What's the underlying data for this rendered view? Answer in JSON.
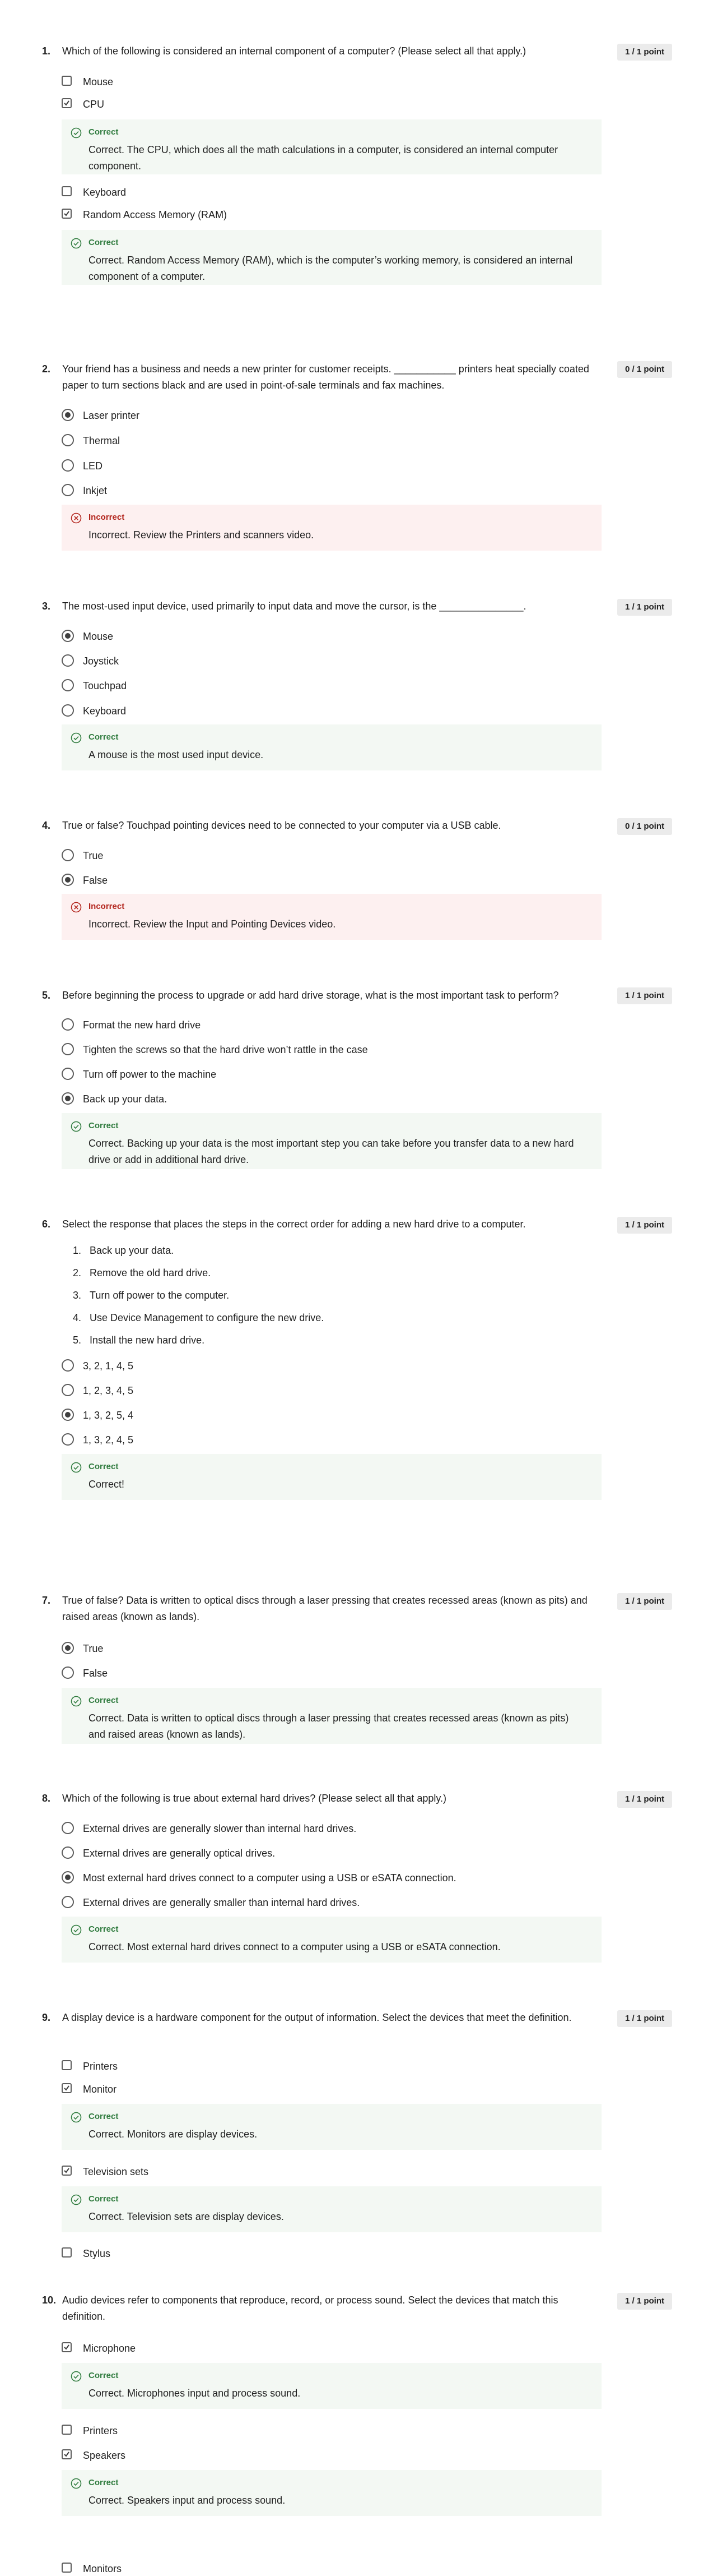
{
  "colors": {
    "correct_text": "#2f7b3e",
    "correct_bg": "#f3f8f3",
    "incorrect_text": "#b3261e",
    "incorrect_bg": "#fdf0f0",
    "score_bg": "#ebebeb"
  },
  "questions": [
    {
      "number": "1.",
      "text": "Which of the following is considered an internal component of a computer? (Please select all that apply.)",
      "score": "1 / 1 point",
      "type": "checkbox",
      "options": [
        {
          "label": "Mouse",
          "selected": false
        },
        {
          "label": "CPU",
          "selected": true,
          "feedback": {
            "status": "correct",
            "title": "Correct",
            "message": "Correct. The CPU, which does all the math calculations in a computer, is considered an internal computer component."
          }
        },
        {
          "label": "Keyboard",
          "selected": false
        },
        {
          "label": "Random Access Memory (RAM)",
          "selected": true,
          "feedback": {
            "status": "correct",
            "title": "Correct",
            "message": "Correct. Random Access Memory (RAM), which is the computer’s working memory, is considered an internal component of a computer."
          }
        }
      ]
    },
    {
      "number": "2.",
      "text": "Your friend has a business and needs a new printer for customer receipts. ___________ printers heat specially coated paper to turn sections black and are used in point-of-sale terminals and fax machines.",
      "score": "0 / 1 point",
      "type": "radio",
      "options": [
        {
          "label": "Laser printer",
          "selected": true
        },
        {
          "label": "Thermal",
          "selected": false
        },
        {
          "label": "LED",
          "selected": false
        },
        {
          "label": "Inkjet",
          "selected": false
        }
      ],
      "feedback": {
        "status": "incorrect",
        "title": "Incorrect",
        "message": "Incorrect. Review the Printers and scanners video."
      }
    },
    {
      "number": "3.",
      "text": "The most-used input device, used primarily to input data and move the cursor, is the _______________.",
      "score": "1 / 1 point",
      "type": "radio",
      "options": [
        {
          "label": "Mouse",
          "selected": true
        },
        {
          "label": "Joystick",
          "selected": false
        },
        {
          "label": "Touchpad",
          "selected": false
        },
        {
          "label": "Keyboard",
          "selected": false
        }
      ],
      "feedback": {
        "status": "correct",
        "title": "Correct",
        "message": "A mouse is the most used input device."
      }
    },
    {
      "number": "4.",
      "text": "True or false? Touchpad pointing devices need to be connected to your computer via a USB cable.",
      "score": "0 / 1 point",
      "type": "radio",
      "options": [
        {
          "label": "True",
          "selected": false
        },
        {
          "label": "False",
          "selected": true
        }
      ],
      "feedback": {
        "status": "incorrect",
        "title": "Incorrect",
        "message": "Incorrect. Review the Input and Pointing Devices video."
      }
    },
    {
      "number": "5.",
      "text": "Before beginning the process to upgrade or add hard drive storage, what is the most important task to perform?",
      "score": "1 / 1 point",
      "type": "radio",
      "options": [
        {
          "label": "Format the new hard drive",
          "selected": false
        },
        {
          "label": "Tighten the screws so that the hard drive won’t rattle in the case",
          "selected": false
        },
        {
          "label": "Turn off power to the machine",
          "selected": false
        },
        {
          "label": "Back up your data.",
          "selected": true
        }
      ],
      "feedback": {
        "status": "correct",
        "title": "Correct",
        "message": "Correct. Backing up your data is the most important step you can take before you transfer data to a new hard drive or add in additional hard drive."
      }
    },
    {
      "number": "6.",
      "text": "Select the response that places the steps in the correct order for adding a new hard drive to a computer.",
      "score": "1 / 1 point",
      "type": "radio",
      "steps": [
        {
          "n": "1.",
          "text": "Back up your data."
        },
        {
          "n": "2.",
          "text": "Remove the old hard drive."
        },
        {
          "n": "3.",
          "text": "Turn off power to the computer."
        },
        {
          "n": "4.",
          "text": "Use Device Management to configure the new drive."
        },
        {
          "n": "5.",
          "text": "Install the new hard drive."
        }
      ],
      "options": [
        {
          "label": "3, 2, 1, 4, 5",
          "selected": false
        },
        {
          "label": "1, 2, 3, 4, 5",
          "selected": false
        },
        {
          "label": "1, 3, 2, 5, 4",
          "selected": true
        },
        {
          "label": "1, 3, 2, 4, 5",
          "selected": false
        }
      ],
      "feedback": {
        "status": "correct",
        "title": "Correct",
        "message": "Correct!"
      }
    },
    {
      "number": "7.",
      "text": "True of false? Data is written to optical discs through a laser pressing that creates recessed areas (known as pits) and raised areas (known as lands).",
      "score": "1 / 1 point",
      "type": "radio",
      "options": [
        {
          "label": "True",
          "selected": true
        },
        {
          "label": "False",
          "selected": false
        }
      ],
      "feedback": {
        "status": "correct",
        "title": "Correct",
        "message": "Correct. Data is written to optical discs through a laser pressing that creates recessed areas (known as pits) and raised areas (known as lands)."
      }
    },
    {
      "number": "8.",
      "text": "Which of the following is true about external hard drives? (Please select all that apply.)",
      "score": "1 / 1 point",
      "type": "radio",
      "options": [
        {
          "label": "External drives are generally slower than internal hard drives.",
          "selected": false
        },
        {
          "label": "External drives are generally optical drives.",
          "selected": false
        },
        {
          "label": "Most external hard drives connect to a computer using a USB or eSATA connection.",
          "selected": true
        },
        {
          "label": "External drives are generally smaller than internal hard drives.",
          "selected": false
        }
      ],
      "feedback": {
        "status": "correct",
        "title": "Correct",
        "message": "Correct. Most external hard drives connect to a computer using a USB or eSATA connection."
      }
    },
    {
      "number": "9.",
      "text": "A display device is a hardware component for the output of information. Select the devices that meet the definition.",
      "score": "1 / 1 point",
      "type": "checkbox",
      "options": [
        {
          "label": "Printers",
          "selected": false
        },
        {
          "label": "Monitor",
          "selected": true,
          "feedback": {
            "status": "correct",
            "title": "Correct",
            "message": "Correct. Monitors are display devices."
          }
        },
        {
          "label": "Television sets",
          "selected": true,
          "feedback": {
            "status": "correct",
            "title": "Correct",
            "message": "Correct. Television sets are display devices."
          }
        },
        {
          "label": "Stylus",
          "selected": false
        }
      ]
    },
    {
      "number": "10.",
      "text": "Audio devices refer to components that reproduce, record, or process sound. Select the devices that match this definition.",
      "score": "1 / 1 point",
      "type": "checkbox",
      "options": [
        {
          "label": "Microphone",
          "selected": true,
          "feedback": {
            "status": "correct",
            "title": "Correct",
            "message": "Correct. Microphones input and process sound."
          }
        },
        {
          "label": "Printers",
          "selected": false
        },
        {
          "label": "Speakers",
          "selected": true,
          "feedback": {
            "status": "correct",
            "title": "Correct",
            "message": "Correct. Speakers input and process sound."
          }
        },
        {
          "label": "Monitors",
          "selected": false
        }
      ]
    }
  ]
}
